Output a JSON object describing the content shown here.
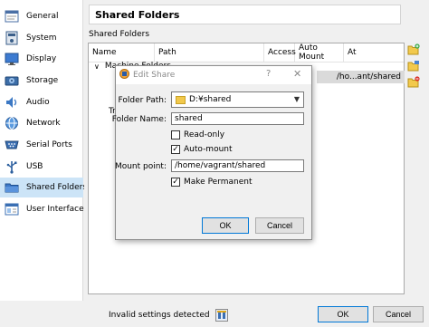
{
  "sidebar": {
    "items": [
      {
        "label": "General",
        "icon": "general-icon"
      },
      {
        "label": "System",
        "icon": "system-icon"
      },
      {
        "label": "Display",
        "icon": "display-icon"
      },
      {
        "label": "Storage",
        "icon": "storage-icon"
      },
      {
        "label": "Audio",
        "icon": "audio-icon"
      },
      {
        "label": "Network",
        "icon": "network-icon"
      },
      {
        "label": "Serial Ports",
        "icon": "serial-port-icon"
      },
      {
        "label": "USB",
        "icon": "usb-icon"
      },
      {
        "label": "Shared Folders",
        "icon": "shared-folder-icon"
      },
      {
        "label": "User Interface",
        "icon": "user-interface-icon"
      }
    ],
    "active_index": 8
  },
  "page": {
    "title": "Shared Folders",
    "section_label": "Shared Folders"
  },
  "table": {
    "columns": [
      "Name",
      "Path",
      "Access",
      "Auto Mount",
      "At"
    ],
    "tree_group": "Machine Folders",
    "tree_group_cut": "Tra",
    "row_at_value": "/ho...ant/shared"
  },
  "dialog": {
    "title": "Edit Share",
    "help_glyph": "?",
    "close_glyph": "✕",
    "folder_path_label": "Folder Path:",
    "folder_path_value": "D:¥shared",
    "folder_name_label": "Folder Name:",
    "folder_name_value": "shared",
    "read_only_label": "Read-only",
    "read_only_checked": false,
    "auto_mount_label": "Auto-mount",
    "auto_mount_checked": true,
    "mount_point_label": "Mount point:",
    "mount_point_value": "/home/vagrant/shared",
    "make_permanent_label": "Make Permanent",
    "make_permanent_checked": true,
    "ok_label": "OK",
    "cancel_label": "Cancel"
  },
  "footer": {
    "status_text": "Invalid settings detected",
    "ok_label": "OK",
    "cancel_label": "Cancel"
  },
  "colors": {
    "selection": "#cce4f7",
    "default_button_border": "#0078d7"
  }
}
